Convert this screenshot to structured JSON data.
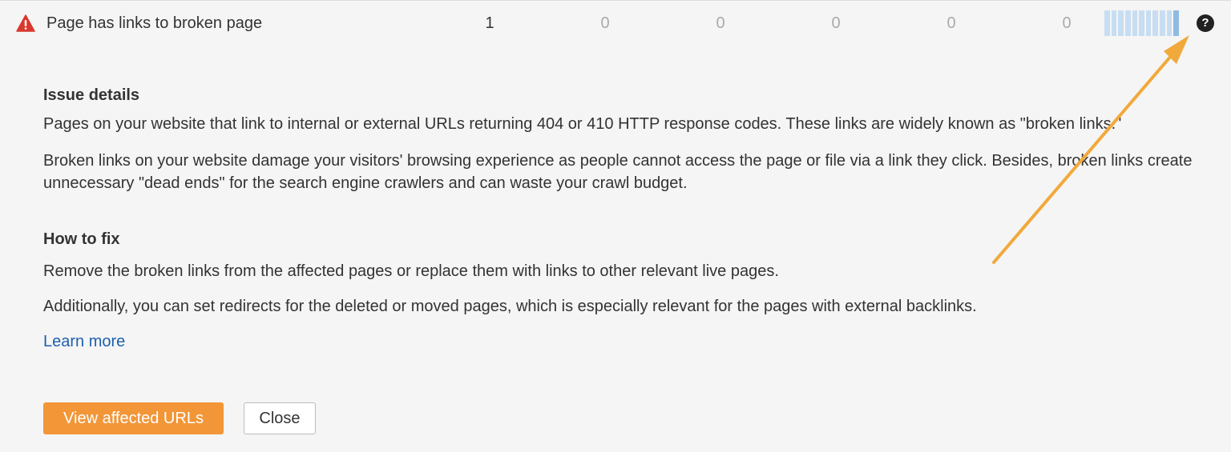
{
  "issue": {
    "title": "Page has links to broken page",
    "severity_icon": "warning-triangle-icon",
    "severity_color": "#d9382f",
    "counts": [
      "1",
      "0",
      "0",
      "0",
      "0",
      "0"
    ],
    "trend_icon": "trend-bars-icon",
    "help_icon": "question-circle-icon",
    "help_glyph": "?"
  },
  "details": {
    "issue_title": "Issue details",
    "issue_paragraphs": [
      "Pages on your website that link to internal or external URLs returning 404 or 410 HTTP response codes. These links are widely known as \"broken links.\"",
      "Broken links on your website damage your visitors' browsing experience as people cannot access the page or file via a link they click. Besides, broken links create unnecessary \"dead ends\" for the search engine crawlers and can waste your crawl budget."
    ],
    "fix_title": "How to fix",
    "fix_paragraphs": [
      "Remove the broken links from the affected pages or replace them with links to other relevant live pages.",
      "Additionally, you can set redirects for the deleted or moved pages, which is especially relevant for the pages with external backlinks."
    ],
    "learn_more": "Learn more"
  },
  "actions": {
    "view_affected": "View affected URLs",
    "close": "Close"
  },
  "colors": {
    "accent": "#f29638",
    "link": "#1f5fae",
    "annotation_arrow": "#f2a93b",
    "trend_bar": "#c7ddf2"
  }
}
